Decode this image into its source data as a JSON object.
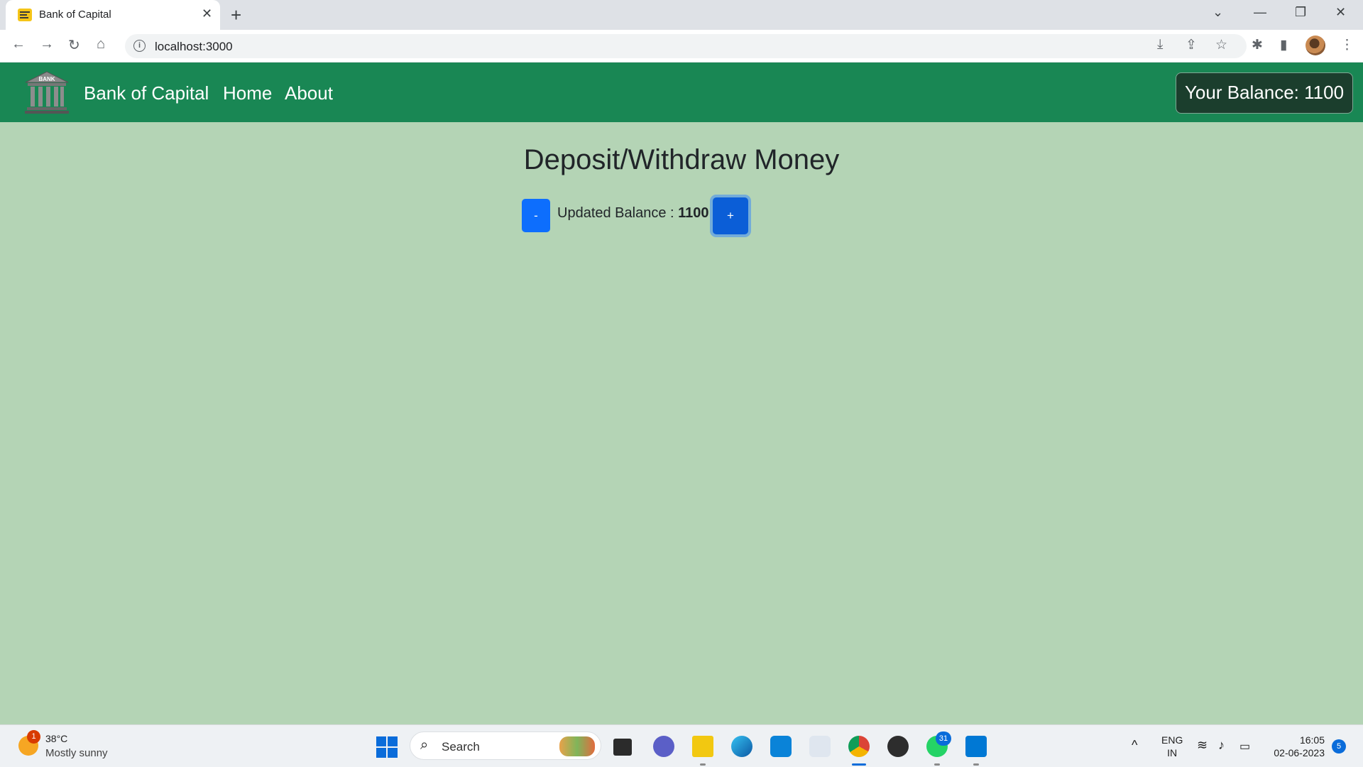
{
  "browser": {
    "tab_title": "Bank of Capital",
    "tab_close": "✕",
    "new_tab": "+",
    "url": "localhost:3000",
    "window_controls": {
      "dropdown": "⌄",
      "minimize": "—",
      "restore": "❐",
      "close": "✕"
    },
    "nav": {
      "back": "←",
      "forward": "→",
      "reload": "↻",
      "home": "⌂"
    },
    "toolbar_icons": {
      "install": "⤓",
      "share": "⇪",
      "bookmark": "☆",
      "extensions": "✱",
      "sidepanel": "▮",
      "menu": "⋮"
    }
  },
  "navbar": {
    "logo_text": "BANK",
    "brand": "Bank of Capital",
    "links": [
      "Home",
      "About"
    ],
    "balance_label": "Your Balance: 1100"
  },
  "main": {
    "title": "Deposit/Withdraw Money",
    "minus_label": "-",
    "plus_label": "+",
    "balance_prefix": "Updated Balance : ",
    "balance_value": "1100"
  },
  "taskbar": {
    "weather_badge": "1",
    "temperature": "38°C",
    "weather": "Mostly sunny",
    "search_label": "Search",
    "whatsapp_badge": "31",
    "language_top": "ENG",
    "language_bottom": "IN",
    "time": "16:05",
    "date": "02-06-2023",
    "notification_count": "5",
    "tray_chevron": "^",
    "icons": [
      "start-icon",
      "task-view-icon",
      "teams-icon",
      "file-explorer-icon",
      "edge-icon",
      "cortana-icon",
      "app-icon",
      "chrome-icon",
      "media-player-icon",
      "whatsapp-icon",
      "vscode-icon"
    ]
  },
  "colors": {
    "navbar": "#198754",
    "page_bg": "#b4d4b5",
    "button_primary": "#0d6efd",
    "balance_box": "#1b3e2d"
  }
}
